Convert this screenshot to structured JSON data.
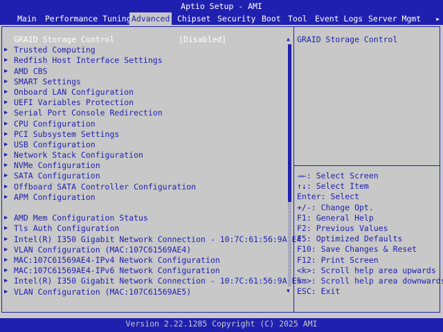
{
  "title": "Aptio Setup - AMI",
  "menu": {
    "tabs": [
      "Main",
      "Performance Tuning",
      "Advanced",
      "Chipset",
      "Security",
      "Boot",
      "Tool",
      "Event Logs",
      "Server Mgmt"
    ],
    "active": "Advanced",
    "more_arrow": "▸"
  },
  "items": [
    {
      "label": "GRAID Storage Control",
      "value": "[Disabled]",
      "submenu": false,
      "selected": true
    },
    {
      "label": "Trusted Computing",
      "submenu": true
    },
    {
      "label": "Redfish Host Interface Settings",
      "submenu": true
    },
    {
      "label": "AMD CBS",
      "submenu": true
    },
    {
      "label": "SMART Settings",
      "submenu": true
    },
    {
      "label": "Onboard LAN Configuration",
      "submenu": true
    },
    {
      "label": "UEFI Variables Protection",
      "submenu": true
    },
    {
      "label": "Serial Port Console Redirection",
      "submenu": true
    },
    {
      "label": "CPU Configuration",
      "submenu": true
    },
    {
      "label": "PCI Subsystem Settings",
      "submenu": true
    },
    {
      "label": "USB Configuration",
      "submenu": true
    },
    {
      "label": "Network Stack Configuration",
      "submenu": true
    },
    {
      "label": "NVMe Configuration",
      "submenu": true
    },
    {
      "label": "SATA Configuration",
      "submenu": true
    },
    {
      "label": "Offboard SATA Controller Configuration",
      "submenu": true
    },
    {
      "label": "APM Configuration",
      "submenu": true
    },
    {
      "label": "",
      "blank": true
    },
    {
      "label": "AMD Mem Configuration Status",
      "submenu": true
    },
    {
      "label": "Tls Auth Configuration",
      "submenu": true
    },
    {
      "label": "Intel(R) I350 Gigabit Network Connection - 10:7C:61:56:9A:E4",
      "submenu": true
    },
    {
      "label": "VLAN Configuration (MAC:107C61569AE4)",
      "submenu": true
    },
    {
      "label": "MAC:107C61569AE4-IPv4 Network Configuration",
      "submenu": true
    },
    {
      "label": "MAC:107C61569AE4-IPv6 Network Configuration",
      "submenu": true
    },
    {
      "label": "Intel(R) I350 Gigabit Network Connection - 10:7C:61:56:9A:E5",
      "submenu": true
    },
    {
      "label": "VLAN Configuration (MAC:107C61569AE5)",
      "submenu": true
    }
  ],
  "scroll": {
    "up": "▲",
    "down": "▼",
    "position": 0.0,
    "visible_fraction": 0.65
  },
  "help": {
    "title": "GRAID Storage Control"
  },
  "keys": [
    "→←: Select Screen",
    "↑↓: Select Item",
    "Enter: Select",
    "+/-: Change Opt.",
    "F1: General Help",
    "F2: Previous Values",
    "F5: Optimized Defaults",
    "F10: Save Changes & Reset",
    "F12: Print Screen",
    "<k>: Scroll help area upwards",
    "<m>: Scroll help area downwards",
    "ESC: Exit"
  ],
  "footer": "Version 2.22.1285 Copyright (C) 2025 AMI",
  "colors": {
    "bios_blue": "#2020b0",
    "background": "#c8c8c8",
    "selected_text": "#ffffff"
  }
}
